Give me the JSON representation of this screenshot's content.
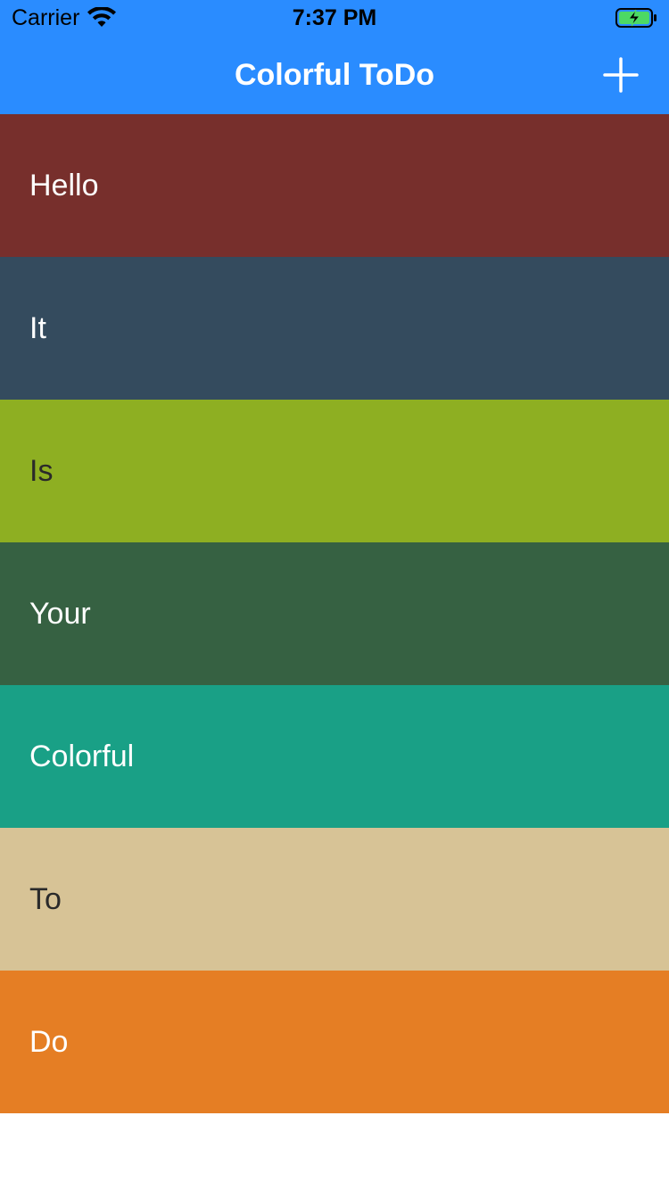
{
  "status_bar": {
    "carrier": "Carrier",
    "time": "7:37 PM"
  },
  "nav": {
    "title": "Colorful ToDo",
    "add_icon": "plus-icon",
    "background": "#2a8cff"
  },
  "todos": [
    {
      "label": "Hello",
      "bg": "#772f2c",
      "fg": "#ffffff"
    },
    {
      "label": "It",
      "bg": "#344b5e",
      "fg": "#ffffff"
    },
    {
      "label": "Is",
      "bg": "#8eaf22",
      "fg": "#2a2a2a"
    },
    {
      "label": "Your",
      "bg": "#366142",
      "fg": "#ffffff"
    },
    {
      "label": "Colorful",
      "bg": "#19a086",
      "fg": "#ffffff"
    },
    {
      "label": "To",
      "bg": "#d7c396",
      "fg": "#2a2a2a"
    },
    {
      "label": "Do",
      "bg": "#e57e24",
      "fg": "#ffffff"
    }
  ]
}
